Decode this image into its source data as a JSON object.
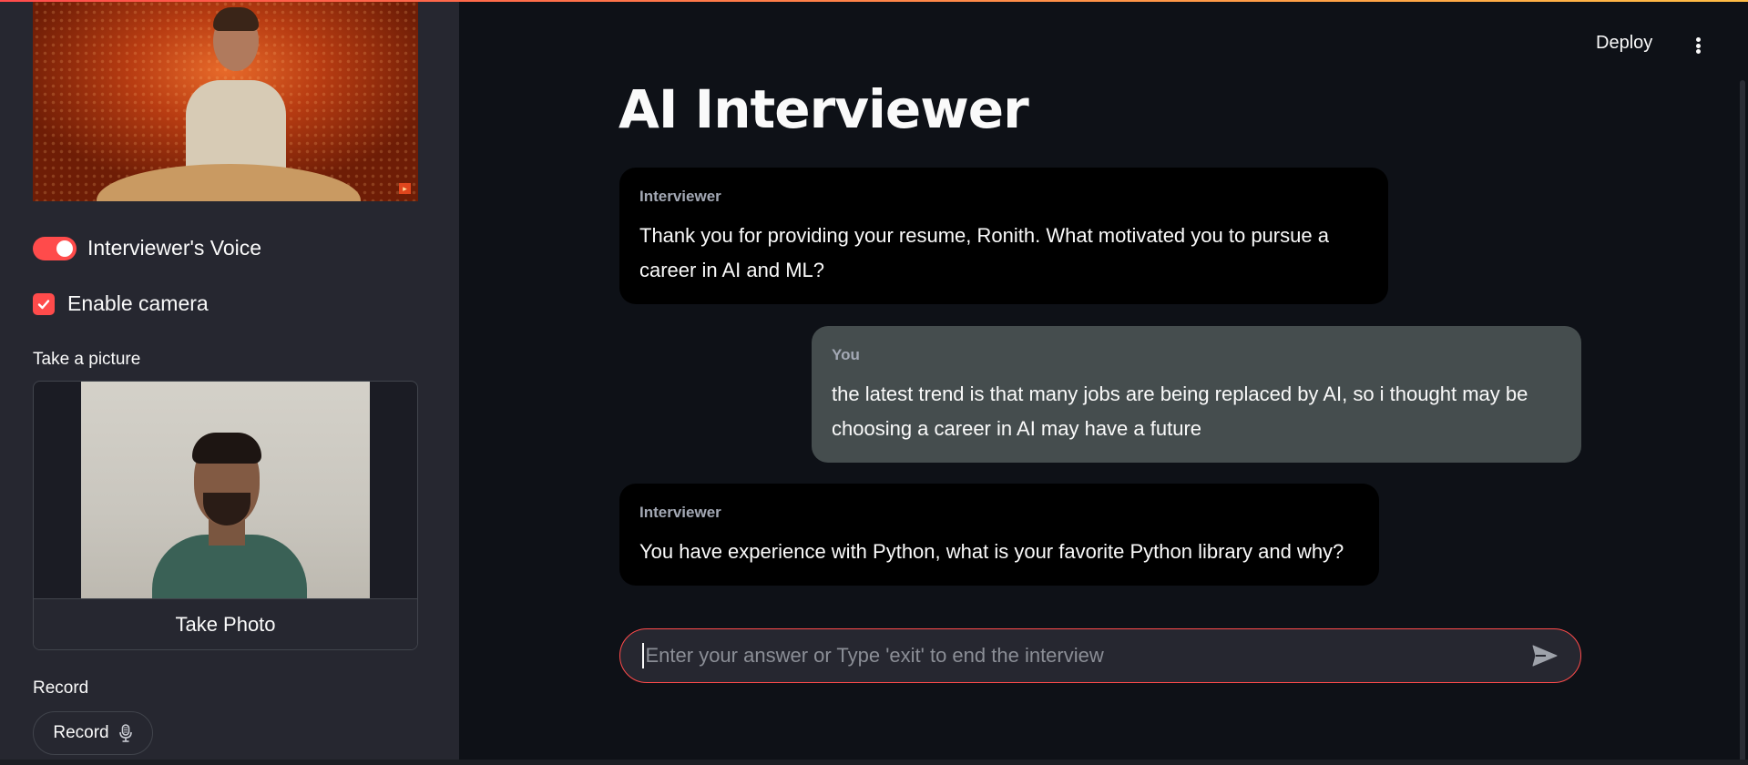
{
  "sidebar": {
    "voice_toggle": {
      "label": "Interviewer's Voice",
      "on": true
    },
    "camera_checkbox": {
      "label": "Enable camera",
      "checked": true
    },
    "camera_input": {
      "label": "Take a picture",
      "button_label": "Take Photo"
    },
    "record": {
      "label": "Record",
      "button_label": "Record"
    }
  },
  "header": {
    "deploy_label": "Deploy"
  },
  "main": {
    "title": "AI Interviewer",
    "messages": [
      {
        "role": "Interviewer",
        "text": "Thank you for providing your resume, Ronith. What motivated you to pursue a career in AI and ML?"
      },
      {
        "role": "You",
        "text": "the latest trend is that many jobs are being replaced by AI, so i thought may be choosing a career in AI may have a future"
      },
      {
        "role": "Interviewer",
        "text": "You have experience with Python, what is your favorite Python library and why?"
      }
    ],
    "chat_input": {
      "placeholder": "Enter your answer or Type 'exit' to end the interview"
    }
  },
  "colors": {
    "accent": "#ff4b4b",
    "background": "#0e1117",
    "sidebar": "#262730",
    "interviewer_bubble": "#000000",
    "user_bubble": "#454d4e"
  },
  "icons": [
    "avatar-video",
    "check-icon",
    "microphone-icon",
    "send-icon",
    "kebab-menu-icon"
  ]
}
